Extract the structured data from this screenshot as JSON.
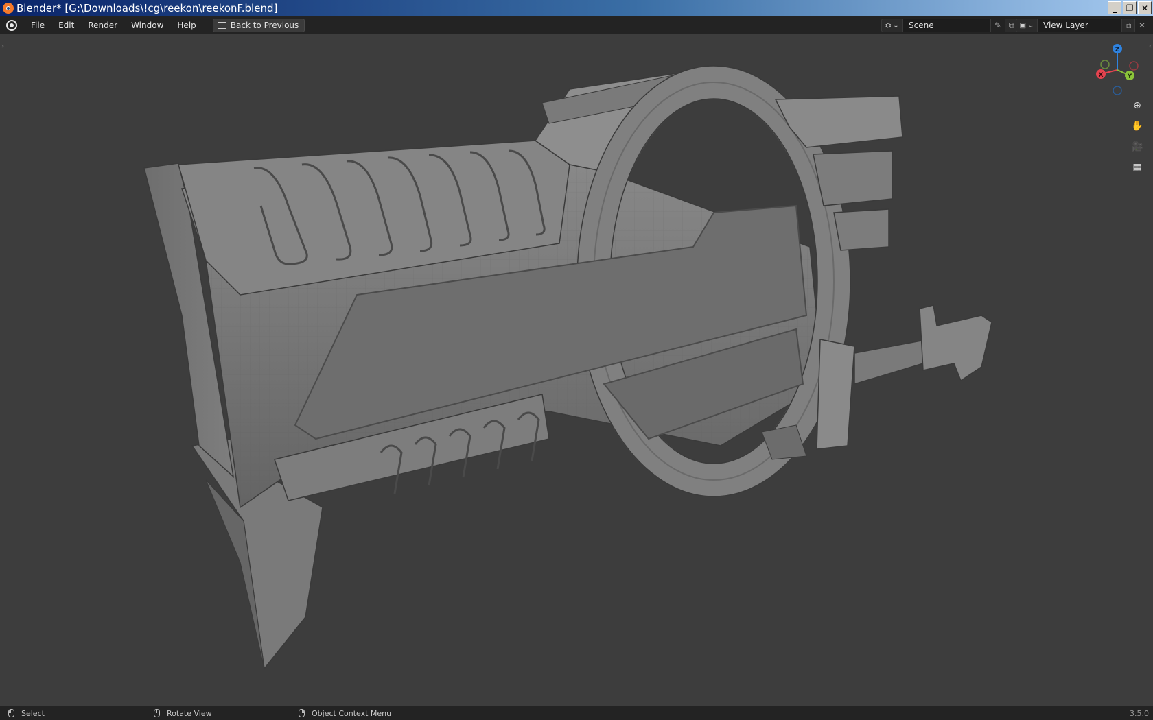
{
  "window": {
    "title": "Blender* [G:\\Downloads\\!cg\\reekon\\reekonF.blend]",
    "buttons": [
      "minimize-icon",
      "restore-icon",
      "close-icon"
    ]
  },
  "menubar": {
    "items": [
      "File",
      "Edit",
      "Render",
      "Window",
      "Help"
    ],
    "back_button": "Back to Previous",
    "scene": {
      "label": "Scene",
      "icon": "scene-icon"
    },
    "view_layer": {
      "label": "View Layer",
      "icon": "view-layer-icon"
    }
  },
  "viewport": {
    "gizmo": {
      "x": "X",
      "y": "Y",
      "z": "Z"
    },
    "colors": {
      "x": "#e4434f",
      "y": "#8bc43a",
      "z": "#2f83e0",
      "background": "#3d3d3d"
    },
    "nav_buttons": [
      "zoom-icon",
      "pan-hand-icon",
      "camera-icon",
      "ortho-grid-icon"
    ]
  },
  "statusbar": {
    "select": "Select",
    "rotate": "Rotate View",
    "context_menu": "Object Context Menu",
    "version": "3.5.0"
  }
}
